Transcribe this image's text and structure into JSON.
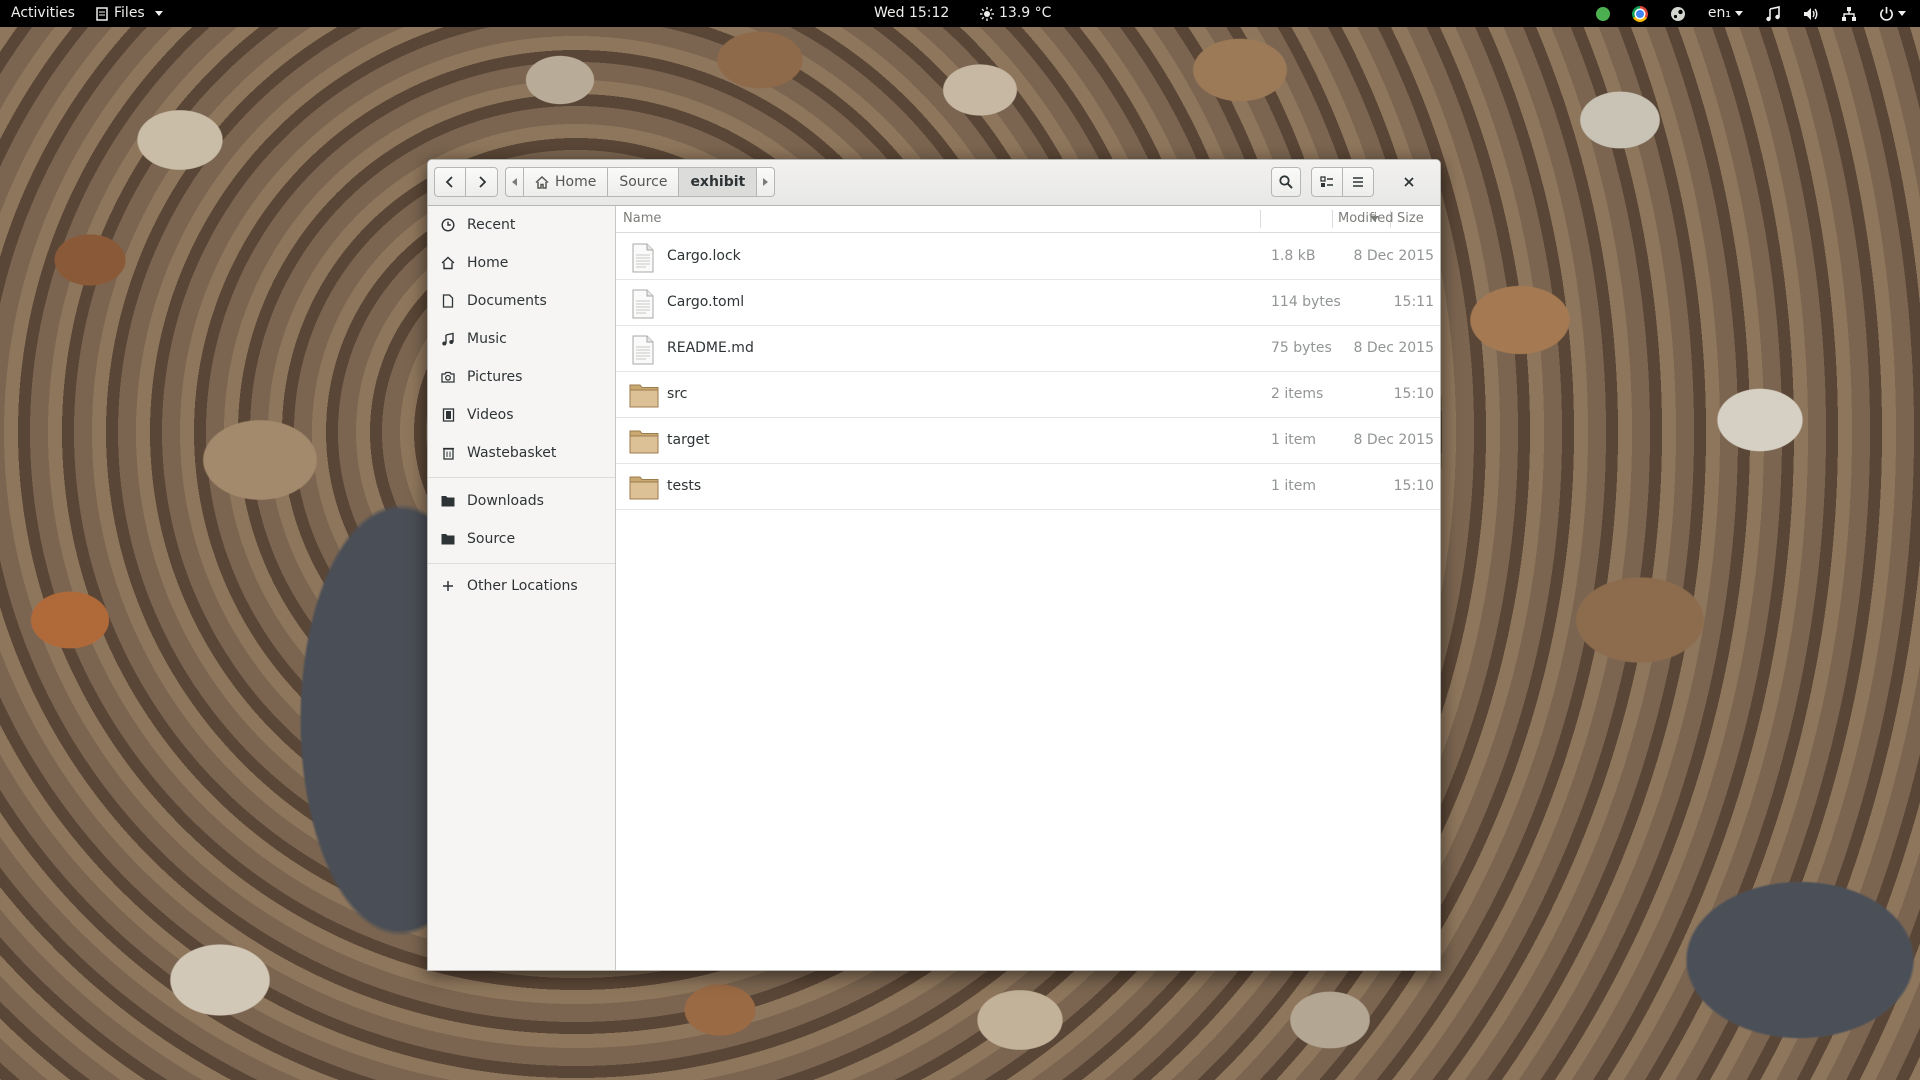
{
  "topbar": {
    "activities": "Activities",
    "app_menu": "Files",
    "clock": "Wed 15:12",
    "weather": "13.9 °C",
    "keyboard_layout": "en₁",
    "status_icons": [
      "green-status-icon",
      "chrome-icon",
      "steam-icon",
      "music-icon",
      "volume-icon",
      "network-icon",
      "power-icon"
    ]
  },
  "window": {
    "pathbar": {
      "segments": [
        "Home",
        "Source",
        "exhibit"
      ],
      "active": "exhibit"
    },
    "sidebar": {
      "items": [
        {
          "label": "Recent",
          "icon": "clock-icon"
        },
        {
          "label": "Home",
          "icon": "home-icon"
        },
        {
          "label": "Documents",
          "icon": "document-icon"
        },
        {
          "label": "Music",
          "icon": "music-note-icon"
        },
        {
          "label": "Pictures",
          "icon": "camera-icon"
        },
        {
          "label": "Videos",
          "icon": "film-icon"
        },
        {
          "label": "Wastebasket",
          "icon": "trash-icon"
        },
        {
          "label": "Downloads",
          "icon": "folder-icon"
        },
        {
          "label": "Source",
          "icon": "folder-icon"
        },
        {
          "label": "Other Locations",
          "icon": "plus-icon"
        }
      ]
    },
    "columns": {
      "name": "Name",
      "size": "Size",
      "modified": "Modified"
    },
    "files": [
      {
        "name": "Cargo.lock",
        "size": "1.8 kB",
        "modified": "8 Dec 2015",
        "type": "file"
      },
      {
        "name": "Cargo.toml",
        "size": "114 bytes",
        "modified": "15:11",
        "type": "file"
      },
      {
        "name": "README.md",
        "size": "75 bytes",
        "modified": "8 Dec 2015",
        "type": "file"
      },
      {
        "name": "src",
        "size": "2 items",
        "modified": "15:10",
        "type": "folder"
      },
      {
        "name": "target",
        "size": "1 item",
        "modified": "8 Dec 2015",
        "type": "folder"
      },
      {
        "name": "tests",
        "size": "1 item",
        "modified": "15:10",
        "type": "folder"
      }
    ]
  },
  "colors": {
    "topbar": "#000000",
    "folder": "#d6b98a",
    "window_bg": "#ffffff",
    "sidebar_bg": "#f6f5f4"
  }
}
